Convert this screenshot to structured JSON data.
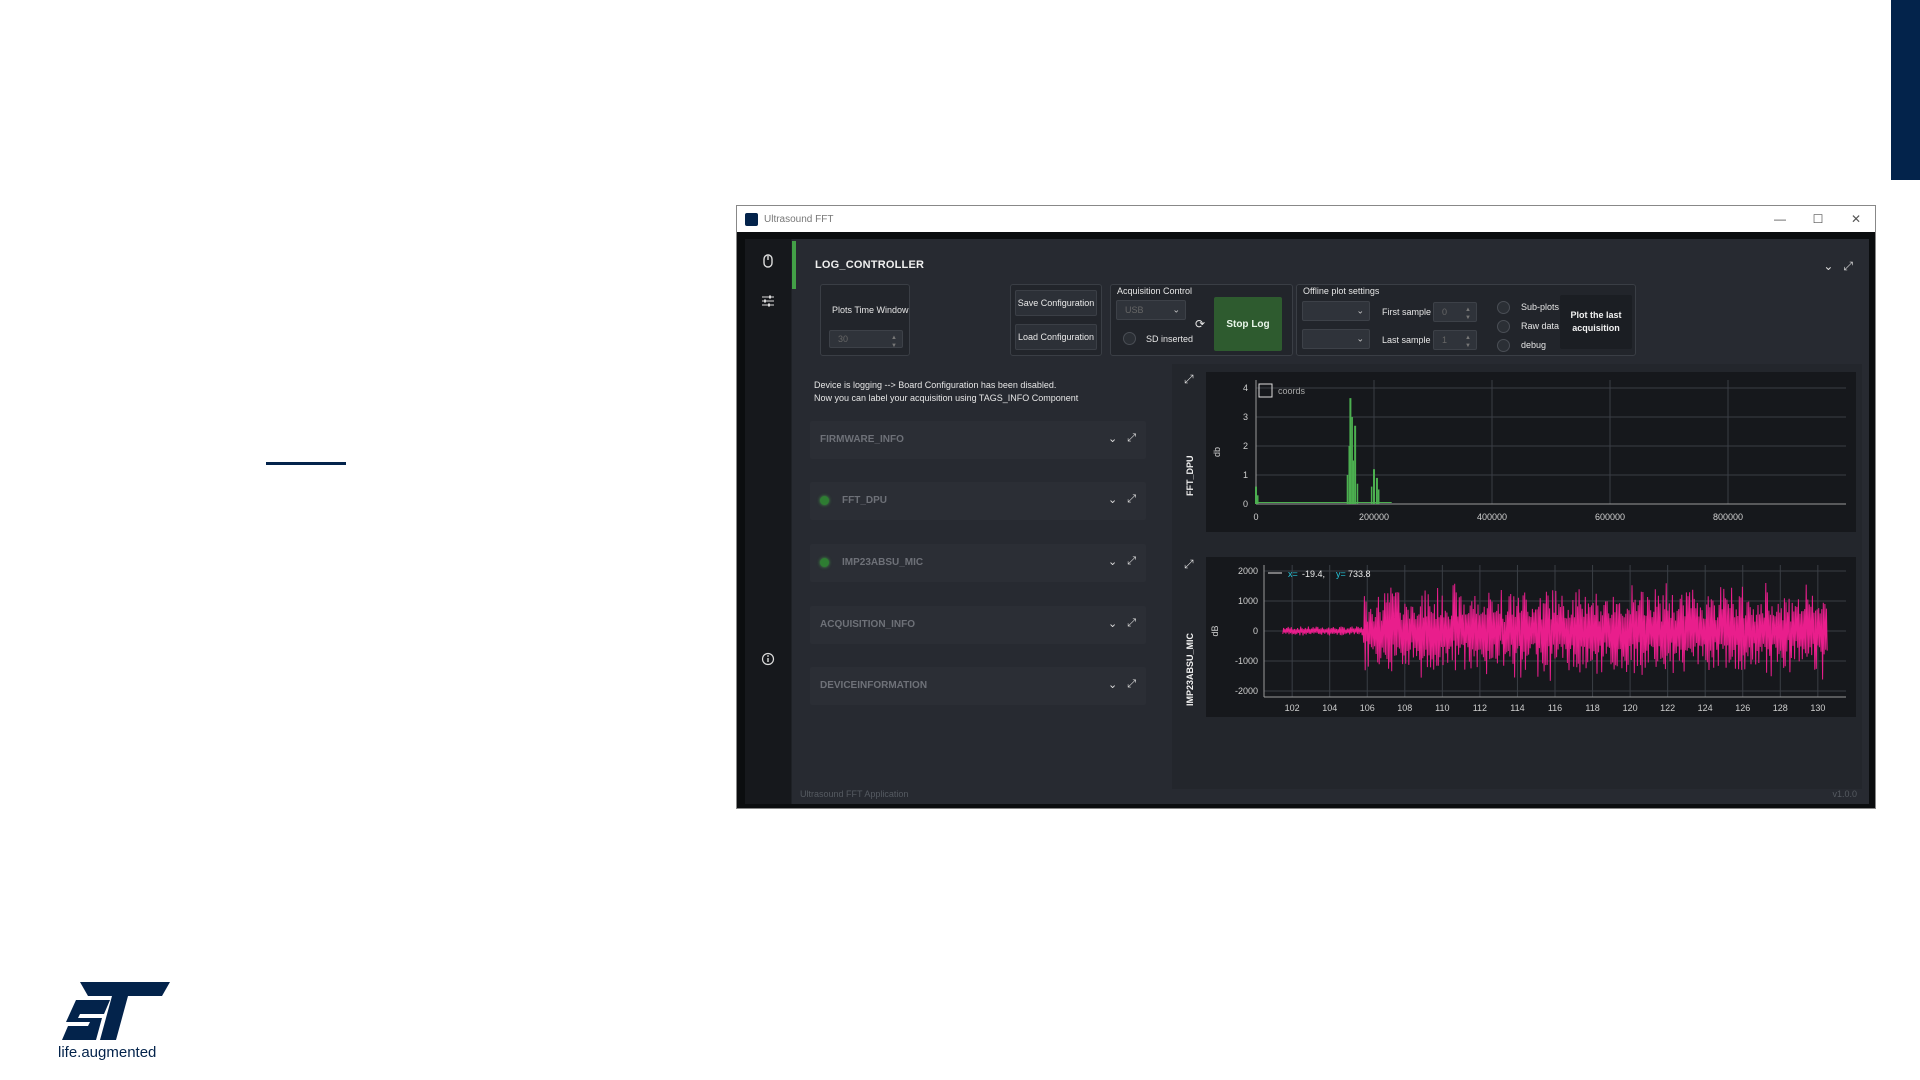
{
  "window": {
    "title": "Ultrasound FFT",
    "controls": [
      "—",
      "☐",
      "✕"
    ]
  },
  "brand": {
    "tagline": "life.augmented",
    "logo_text": "ST",
    "accent_color": "#03234b"
  },
  "sidebar": {
    "items": [
      "mouse-icon",
      "sliders-icon"
    ],
    "bottom": "info-icon"
  },
  "log_controller": {
    "title": "LOG_CONTROLLER",
    "plots_time_window_label": "Plots Time Window",
    "plots_time_window_value": "30",
    "save_label": "Save Configuration",
    "load_label": "Load Configuration",
    "acquisition_control_label": "Acquisition Control",
    "interface_value": "USB",
    "sd_inserted_label": "SD inserted",
    "stop_label": "Stop Log",
    "offline_plot_label": "Offline plot settings",
    "first_sample_label": "First sample",
    "first_sample_value": "0",
    "last_sample_label": "Last sample",
    "last_sample_value": "1",
    "subplots_label": "Sub-plots",
    "raw_data_label": "Raw data",
    "debug_label": "debug",
    "plot_last_label": "Plot the last acquisition"
  },
  "messages": {
    "line1": "Device is logging --> Board Configuration has been disabled.",
    "line2": "Now you can label your acquisition using TAGS_INFO Component"
  },
  "components": [
    {
      "label": "FIRMWARE_INFO",
      "led": false
    },
    {
      "label": "FFT_DPU",
      "led": true
    },
    {
      "label": "IMP23ABSU_MIC",
      "led": true
    },
    {
      "label": "ACQUISITION_INFO",
      "led": false
    },
    {
      "label": "DEVICEINFORMATION",
      "led": false
    }
  ],
  "footer": {
    "app_name": "Ultrasound FFT Application",
    "version": "v1.0.0"
  },
  "chart_data": [
    {
      "type": "line",
      "title": "FFT_DPU",
      "ylabel": "db",
      "legend": "coords",
      "color": "#4caf50",
      "xlim": [
        0,
        1000000
      ],
      "ylim": [
        0,
        4
      ],
      "x_ticks": [
        "0",
        "200000",
        "400000",
        "600000",
        "800000"
      ],
      "y_ticks": [
        "0",
        "1",
        "2",
        "3",
        "4"
      ],
      "peaks": [
        {
          "x": 0,
          "y": 0.6
        },
        {
          "x": 160000,
          "y": 3.65
        },
        {
          "x": 168000,
          "y": 2.7
        },
        {
          "x": 200000,
          "y": 1.2
        },
        {
          "x": 205000,
          "y": 0.9
        }
      ]
    },
    {
      "type": "line",
      "title": "IMP23ABSU_MIC",
      "ylabel": "dB",
      "color": "#e91e8c",
      "cursor_x_label": "x=",
      "cursor_x": "-19.4,",
      "cursor_y_label": "y=",
      "cursor_y": "733.8",
      "xlim": [
        100.5,
        131.5
      ],
      "ylim": [
        -2200,
        2200
      ],
      "x_ticks": [
        "102",
        "104",
        "106",
        "108",
        "110",
        "112",
        "114",
        "116",
        "118",
        "120",
        "122",
        "124",
        "126",
        "128",
        "130"
      ],
      "y_ticks": [
        "2000",
        "1000",
        "0",
        "-1000",
        "-2000"
      ],
      "signal_start": 101.5,
      "burst_start": 105.8,
      "signal_end": 130.5,
      "quiet_amplitude": 150,
      "burst_amplitude": 1700
    }
  ]
}
